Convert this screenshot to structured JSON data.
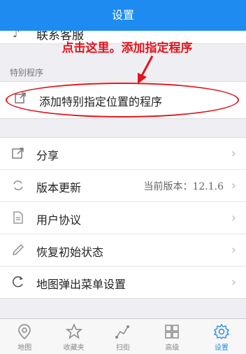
{
  "header": {
    "title": "设置"
  },
  "cut_row": {
    "label": "联系客服"
  },
  "annotation": {
    "text": "点击这里。添加指定程序"
  },
  "special_section": {
    "title": "特别程序",
    "item_label": "添加特别指定位置的程序"
  },
  "menu": {
    "share": {
      "label": "分享"
    },
    "update": {
      "label": "版本更新",
      "value_prefix": "当前版本：",
      "version": "12.1.6"
    },
    "agreement": {
      "label": "用户协议"
    },
    "reset": {
      "label": "恢复初始状态"
    },
    "map_popup": {
      "label": "地图弹出菜单设置"
    }
  },
  "tabs": [
    {
      "label": "地图",
      "icon": "map-pin-icon"
    },
    {
      "label": "收藏夹",
      "icon": "star-icon"
    },
    {
      "label": "扫街",
      "icon": "route-icon"
    },
    {
      "label": "高级",
      "icon": "grid-icon"
    },
    {
      "label": "设置",
      "icon": "gear-icon",
      "active": true
    }
  ],
  "colors": {
    "header": "#1e8bf0",
    "annotation": "#e0161d",
    "active_tab": "#1e8bf0"
  }
}
